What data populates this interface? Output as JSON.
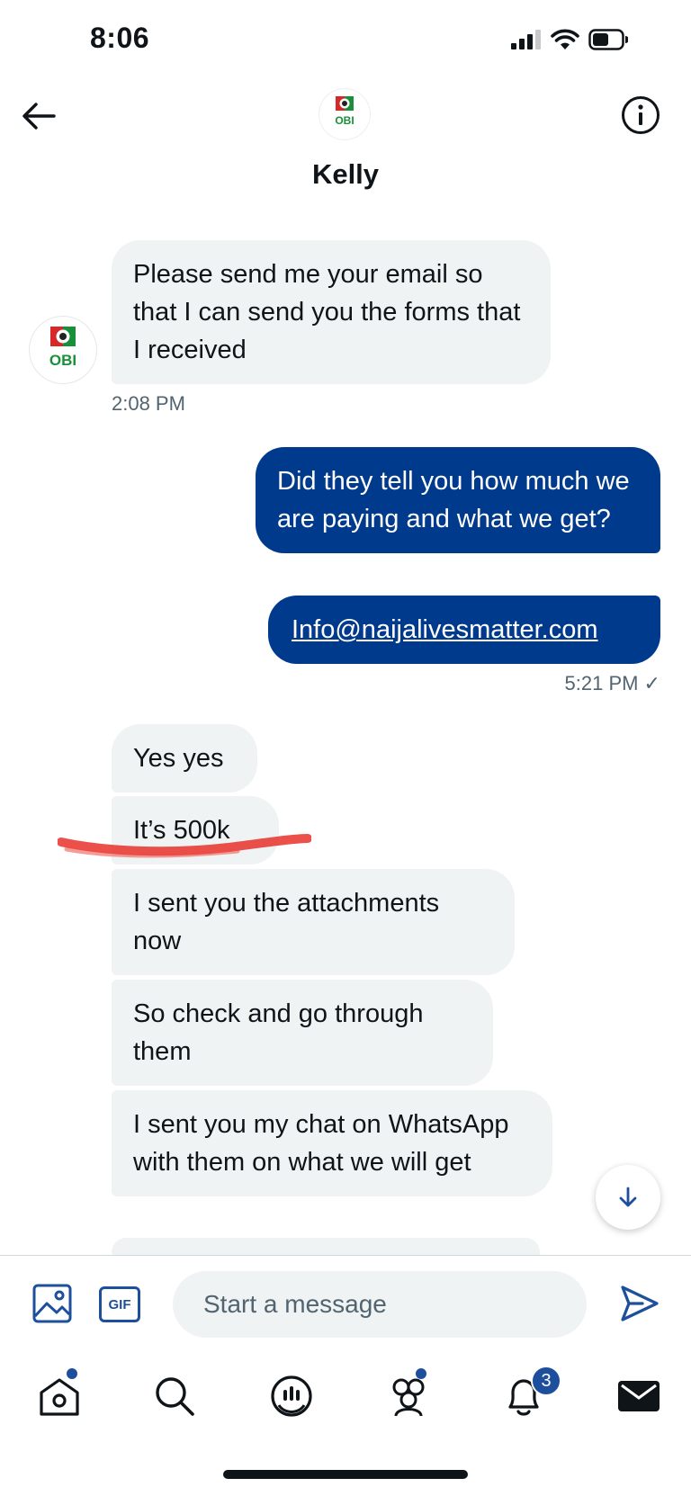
{
  "status_bar": {
    "time": "8:06"
  },
  "header": {
    "contact_name": "Kelly",
    "avatar_text": "OBI"
  },
  "messages": [
    {
      "dir": "in",
      "text": "Please send me your email so that I can send you the forms that I received"
    },
    {
      "dir": "out",
      "text": "Did they tell you how much we are paying and what we get?"
    },
    {
      "dir": "out",
      "text": "Info@naijalivesmatter.com",
      "is_link": true
    },
    {
      "dir": "in",
      "text": "Yes yes"
    },
    {
      "dir": "in",
      "text": "It’s 500k"
    },
    {
      "dir": "in",
      "text": "I sent you the attachments now"
    },
    {
      "dir": "in",
      "text": "So check and go through them"
    },
    {
      "dir": "in",
      "text": "I sent you my chat on WhatsApp with them on what we will get"
    }
  ],
  "timestamps": {
    "first": "2:08 PM",
    "second": "5:21 PM ✓"
  },
  "compose": {
    "placeholder": "Start a message",
    "gif_label": "GIF"
  },
  "nav": {
    "notifications_badge": "3"
  },
  "colors": {
    "outgoing_bubble": "#003a8c",
    "incoming_bubble": "#eff3f4",
    "accent": "#1d4f9c",
    "annotation_line": "#e8312a"
  }
}
